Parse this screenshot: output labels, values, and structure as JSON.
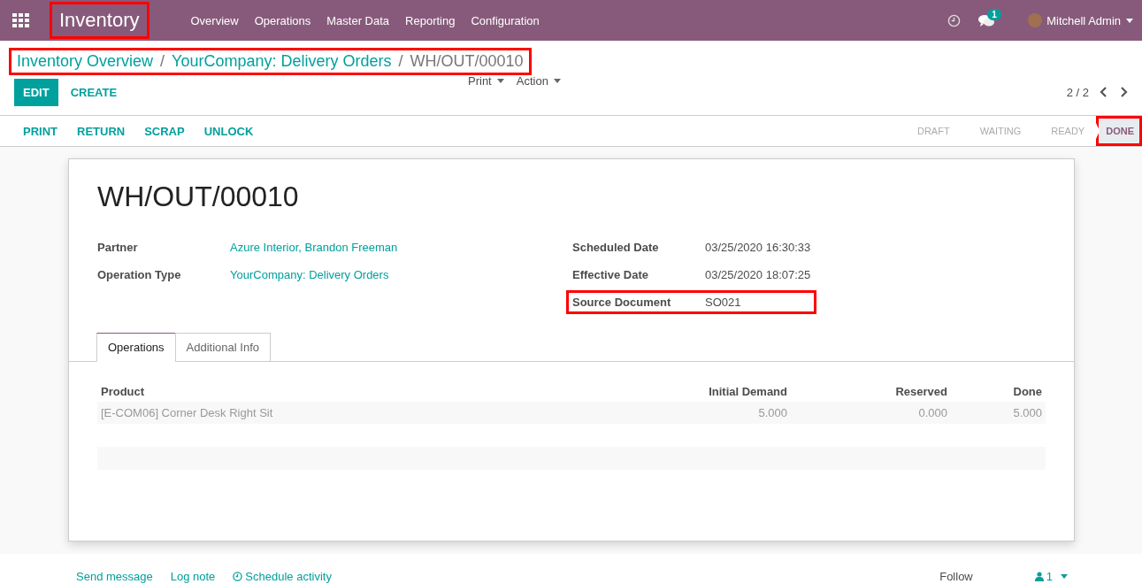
{
  "navbar": {
    "app_title": {
      "text": "Inventory",
      "highlighted": true
    },
    "menu": [
      "Overview",
      "Operations",
      "Master Data",
      "Reporting",
      "Configuration"
    ],
    "messages_badge": "1",
    "user": "Mitchell Admin"
  },
  "breadcrumbs": {
    "highlighted": true,
    "separator": "/",
    "items": [
      {
        "label": "Inventory Overview",
        "kind": "link"
      },
      {
        "label": "YourCompany: Delivery Orders",
        "kind": "link"
      },
      {
        "label": "WH/OUT/00010",
        "kind": "current"
      }
    ]
  },
  "buttons": [
    {
      "label": "EDIT",
      "kind": "primary"
    },
    {
      "label": "CREATE",
      "kind": "secondary"
    }
  ],
  "dropdowns": [
    "Print",
    "Action"
  ],
  "pager": "2 / 2",
  "status_actions": [
    "PRINT",
    "RETURN",
    "SCRAP",
    "UNLOCK"
  ],
  "stages": [
    {
      "label": "DRAFT",
      "selected": false,
      "highlighted": false
    },
    {
      "label": "WAITING",
      "selected": false,
      "highlighted": false
    },
    {
      "label": "READY",
      "selected": false,
      "highlighted": false
    },
    {
      "label": "DONE",
      "selected": true,
      "highlighted": true
    }
  ],
  "record": {
    "title": "WH/OUT/00010",
    "left_fields": [
      {
        "label": "Partner",
        "value": "Azure Interior, Brandon Freeman",
        "kind": "link",
        "highlighted": false
      },
      {
        "label": "Operation Type",
        "value": "YourCompany: Delivery Orders",
        "kind": "link",
        "highlighted": false
      }
    ],
    "right_fields": [
      {
        "label": "Scheduled Date",
        "value": "03/25/2020 16:30:33",
        "kind": "text",
        "highlighted": false
      },
      {
        "label": "Effective Date",
        "value": "03/25/2020 18:07:25",
        "kind": "text",
        "highlighted": false
      },
      {
        "label": "Source Document",
        "value": "SO021",
        "kind": "text",
        "highlighted": true
      }
    ]
  },
  "tabs": [
    {
      "label": "Operations",
      "selected": true
    },
    {
      "label": "Additional Info",
      "selected": false
    }
  ],
  "table": {
    "columns": [
      "Product",
      "Initial Demand",
      "Reserved",
      "Done"
    ],
    "rows": [
      {
        "cells": [
          "[E-COM06] Corner Desk Right Sit",
          "5.000",
          "0.000",
          "5.000"
        ],
        "muted": true
      }
    ]
  },
  "chatter": {
    "actions": [
      {
        "label": "Send message",
        "kind": "plain"
      },
      {
        "label": "Log note",
        "kind": "plain"
      },
      {
        "label": "Schedule activity",
        "kind": "clock"
      }
    ],
    "follow": "Follow",
    "followers": "1"
  }
}
